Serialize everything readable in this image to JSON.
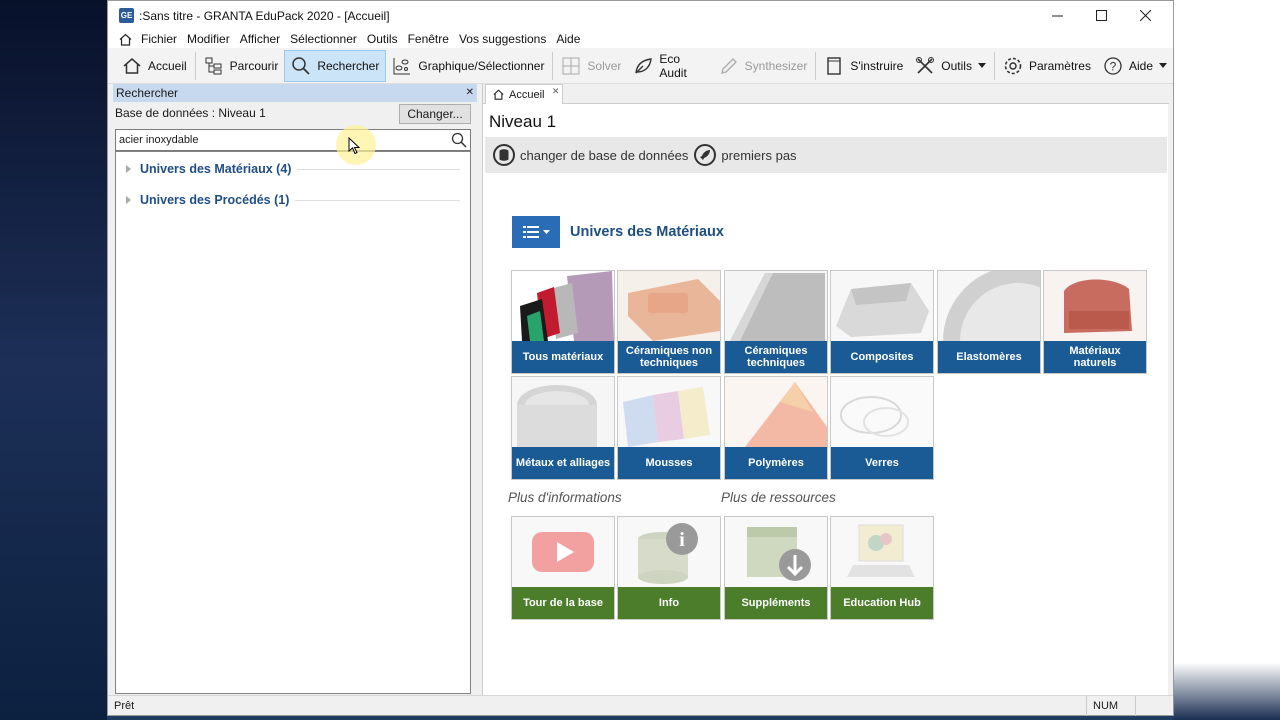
{
  "window": {
    "title": ":Sans titre - GRANTA EduPack 2020 - [Accueil]",
    "app_icon": "GE"
  },
  "menu": [
    "Fichier",
    "Modifier",
    "Afficher",
    "Sélectionner",
    "Outils",
    "Fenêtre",
    "Vos suggestions",
    "Aide"
  ],
  "toolbar": {
    "accueil": "Accueil",
    "parcourir": "Parcourir",
    "rechercher": "Rechercher",
    "graphique": "Graphique/Sélectionner",
    "solver": "Solver",
    "eco_audit": "Eco Audit",
    "synthesizer": "Synthesizer",
    "sinstruire": "S'instruire",
    "outils": "Outils",
    "parametres": "Paramètres",
    "aide": "Aide"
  },
  "search_panel": {
    "title": "Rechercher",
    "database_label": "Base de données : Niveau 1",
    "change_button": "Changer...",
    "search_value": "acier inoxydable",
    "results": [
      {
        "label": "Univers des Matériaux (4)"
      },
      {
        "label": "Univers des Procédés (1)"
      }
    ]
  },
  "home_tab": {
    "tab_label": "Accueil",
    "heading": "Niveau 1",
    "links": {
      "change_db": "changer de base de données",
      "first_steps": "premiers pas"
    },
    "universe_title": "Univers des Matériaux",
    "material_tiles": [
      {
        "label": "Tous matériaux"
      },
      {
        "label": "Céramiques non techniques"
      },
      {
        "label": "Céramiques techniques"
      },
      {
        "label": "Composites"
      },
      {
        "label": "Elastomères"
      },
      {
        "label": "Matériaux naturels"
      },
      {
        "label": "Métaux et alliages"
      },
      {
        "label": "Mousses"
      },
      {
        "label": "Polymères"
      },
      {
        "label": "Verres"
      }
    ],
    "more_info_label": "Plus d'informations",
    "more_resources_label": "Plus de ressources",
    "resource_tiles": [
      {
        "label": "Tour de la base"
      },
      {
        "label": "Info"
      },
      {
        "label": "Suppléments"
      },
      {
        "label": "Education Hub"
      }
    ]
  },
  "status": {
    "text": "Prêt",
    "num": "NUM"
  },
  "colors": {
    "tile_blue": "#1a5b96",
    "tile_green": "#4b7d2b",
    "accent": "#2b6cb6",
    "panel_title": "#c7d9ee"
  }
}
